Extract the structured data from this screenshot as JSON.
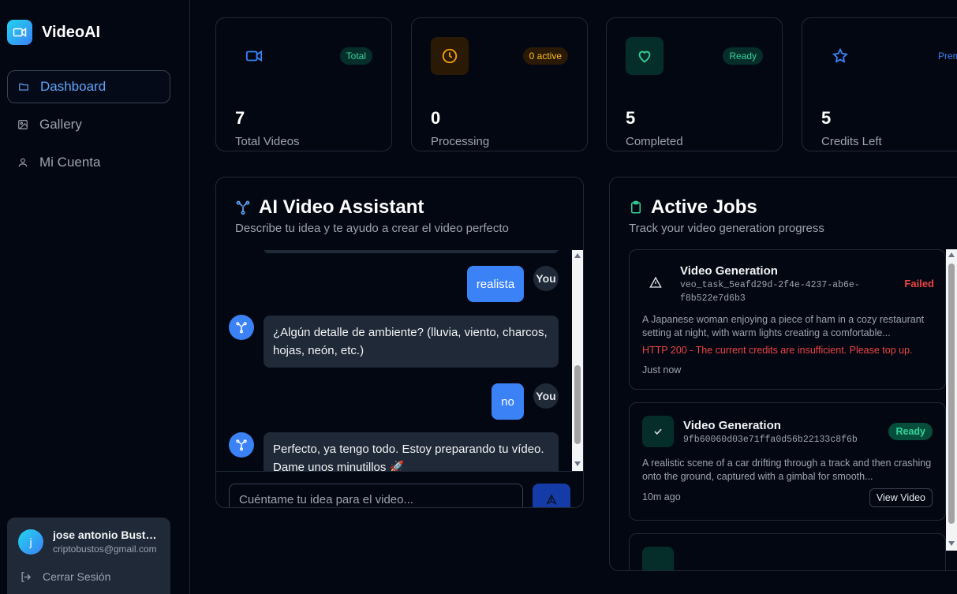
{
  "brand": {
    "name": "VideoAI"
  },
  "nav": [
    {
      "label": "Dashboard",
      "icon": "folder-icon",
      "active": true
    },
    {
      "label": "Gallery",
      "icon": "image-icon"
    },
    {
      "label": "Mi Cuenta",
      "icon": "user-icon"
    }
  ],
  "user": {
    "initial": "j",
    "name": "jose antonio Bustos",
    "email": "criptobustos@gmail.com",
    "logout_label": "Cerrar Sesión"
  },
  "stats": [
    {
      "value": "7",
      "label": "Total Videos",
      "badge": "Total",
      "icon": "video-icon",
      "color": "#3b82f6",
      "badge_bg": "#052e2b",
      "badge_color": "#34d399"
    },
    {
      "value": "0",
      "label": "Processing",
      "badge": "0 active",
      "icon": "clock-icon",
      "color": "#f59e0b",
      "badge_bg": "#2a1a05",
      "badge_color": "#fbbf24"
    },
    {
      "value": "5",
      "label": "Completed",
      "badge": "Ready",
      "icon": "heart-icon",
      "color": "#34d399",
      "badge_bg": "#052e2b",
      "badge_color": "#34d399"
    },
    {
      "value": "5",
      "label": "Credits Left",
      "badge": "Premium",
      "icon": "star-icon",
      "color": "#3b82f6",
      "badge_bg": "transparent",
      "badge_color": "#3b82f6"
    }
  ],
  "assistant": {
    "title": "AI Video Assistant",
    "subtitle": "Describe tu idea y te ayudo a crear el video perfecto",
    "you_label": "You",
    "messages": [
      {
        "role": "user",
        "text": "realista"
      },
      {
        "role": "bot",
        "text": "¿Algún detalle de ambiente? (lluvia, viento, charcos, hojas, neón, etc.)"
      },
      {
        "role": "user",
        "text": "no"
      },
      {
        "role": "bot",
        "text": "Perfecto, ya tengo todo. Estoy preparando tu vídeo. Dame unos minutillos 🚀"
      }
    ],
    "input_placeholder": "Cuéntame tu idea para el video..."
  },
  "jobs": {
    "title": "Active Jobs",
    "subtitle": "Track your video generation progress",
    "items": [
      {
        "title": "Video Generation",
        "id": "veo_task_5eafd29d-2f4e-4237-ab6e-f8b522e7d6b3",
        "status": "Failed",
        "description": "A Japanese woman enjoying a piece of ham in a cozy restaurant setting at night, with warm lights creating a comfortable...",
        "error": "HTTP 200 - The current credits are insufficient. Please top up.",
        "time": "Just now"
      },
      {
        "title": "Video Generation",
        "id": "9fb60060d03e71ffa0d56b22133c8f6b",
        "status": "Ready",
        "description": "A realistic scene of a car drifting through a track and then crashing onto the ground, captured with a gimbal for smooth...",
        "time": "10m ago",
        "action": "View Video"
      }
    ]
  }
}
